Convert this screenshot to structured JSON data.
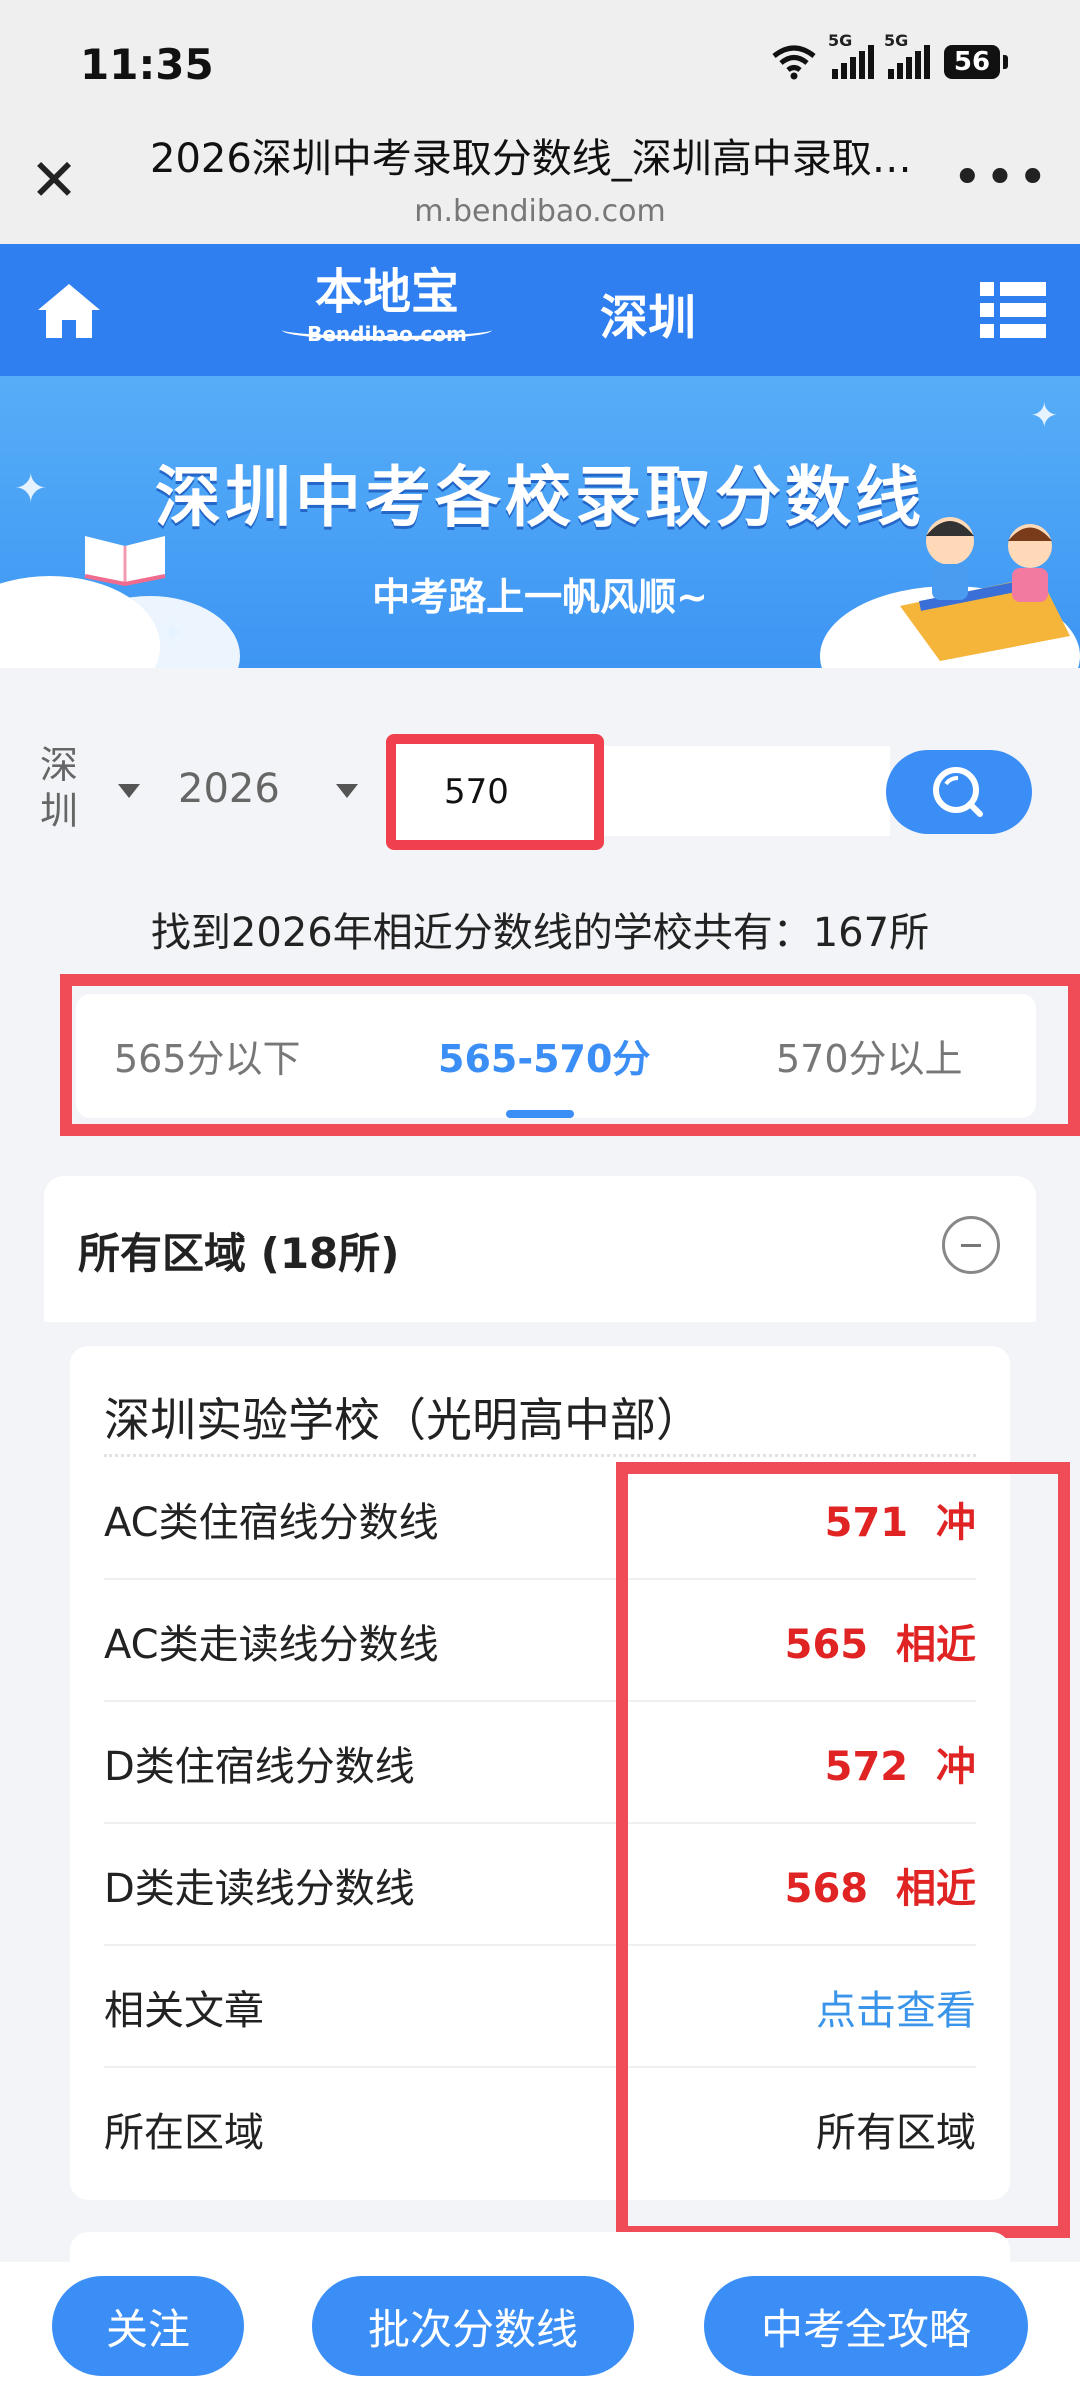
{
  "status_bar": {
    "time": "11:35",
    "network1": "5G",
    "network2": "5G",
    "battery": "56"
  },
  "browser": {
    "title": "2026深圳中考录取分数线_深圳高中录取分数线",
    "url": "m.bendibao.com"
  },
  "header": {
    "logo_cn": "本地宝",
    "logo_en": "Bendibao.com",
    "city": "深圳"
  },
  "banner": {
    "title": "深圳中考各校录取分数线",
    "subtitle": "中考路上一帆风顺~"
  },
  "filters": {
    "city": "深圳",
    "year": "2026",
    "score": "570"
  },
  "result_text": "找到2026年相近分数线的学校共有：167所",
  "tabs": [
    {
      "label": "565分以下"
    },
    {
      "label": "565-570分"
    },
    {
      "label": "570分以上"
    }
  ],
  "region": {
    "title": "所有区域 (18所)"
  },
  "school": {
    "name": "深圳实验学校（光明高中部）",
    "rows": [
      {
        "label": "AC类住宿线分数线",
        "value": "571",
        "tag": "冲"
      },
      {
        "label": "AC类走读线分数线",
        "value": "565",
        "tag": "相近"
      },
      {
        "label": "D类住宿线分数线",
        "value": "572",
        "tag": "冲"
      },
      {
        "label": "D类走读线分数线",
        "value": "568",
        "tag": "相近"
      },
      {
        "label": "相关文章",
        "value": "点击查看"
      },
      {
        "label": "所在区域",
        "value": "所有区域"
      }
    ]
  },
  "bottom_buttons": {
    "follow": "关注",
    "batch": "批次分数线",
    "guide": "中考全攻略"
  }
}
